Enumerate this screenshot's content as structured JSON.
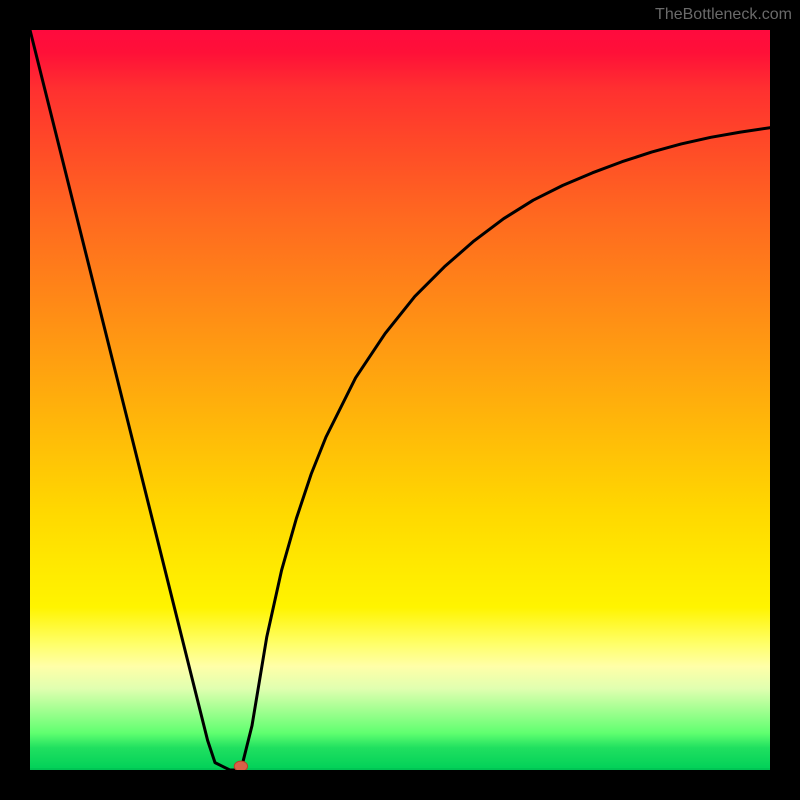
{
  "watermark": "TheBottleneck.com",
  "chart_data": {
    "type": "line",
    "title": "",
    "xlabel": "",
    "ylabel": "",
    "xlim": [
      0,
      100
    ],
    "ylim": [
      0,
      100
    ],
    "grid": false,
    "series": [
      {
        "name": "curve",
        "x": [
          0,
          2,
          4,
          6,
          8,
          10,
          12,
          14,
          16,
          18,
          20,
          22,
          24,
          25,
          26,
          27,
          28,
          28.5,
          29,
          30,
          31,
          32,
          34,
          36,
          38,
          40,
          44,
          48,
          52,
          56,
          60,
          64,
          68,
          72,
          76,
          80,
          84,
          88,
          92,
          96,
          100
        ],
        "values": [
          100,
          92,
          84,
          76,
          68,
          60,
          52,
          44,
          36,
          28,
          20,
          12,
          4,
          1,
          0.5,
          0,
          0,
          0,
          2,
          6,
          12,
          18,
          27,
          34,
          40,
          45,
          53,
          59,
          64,
          68,
          71.5,
          74.5,
          77,
          79,
          80.7,
          82.2,
          83.5,
          84.6,
          85.5,
          86.2,
          86.8
        ]
      }
    ],
    "marker": {
      "x": 28.5,
      "y": 0.5,
      "rx": 0.9,
      "ry": 0.7,
      "color": "#d86048"
    }
  },
  "colors": {
    "background_frame": "#000000",
    "watermark": "#6a6a6a",
    "curve": "#000000",
    "gradient_top": "#ff0a3e",
    "gradient_bottom": "#00d058",
    "marker": "#d86048"
  }
}
